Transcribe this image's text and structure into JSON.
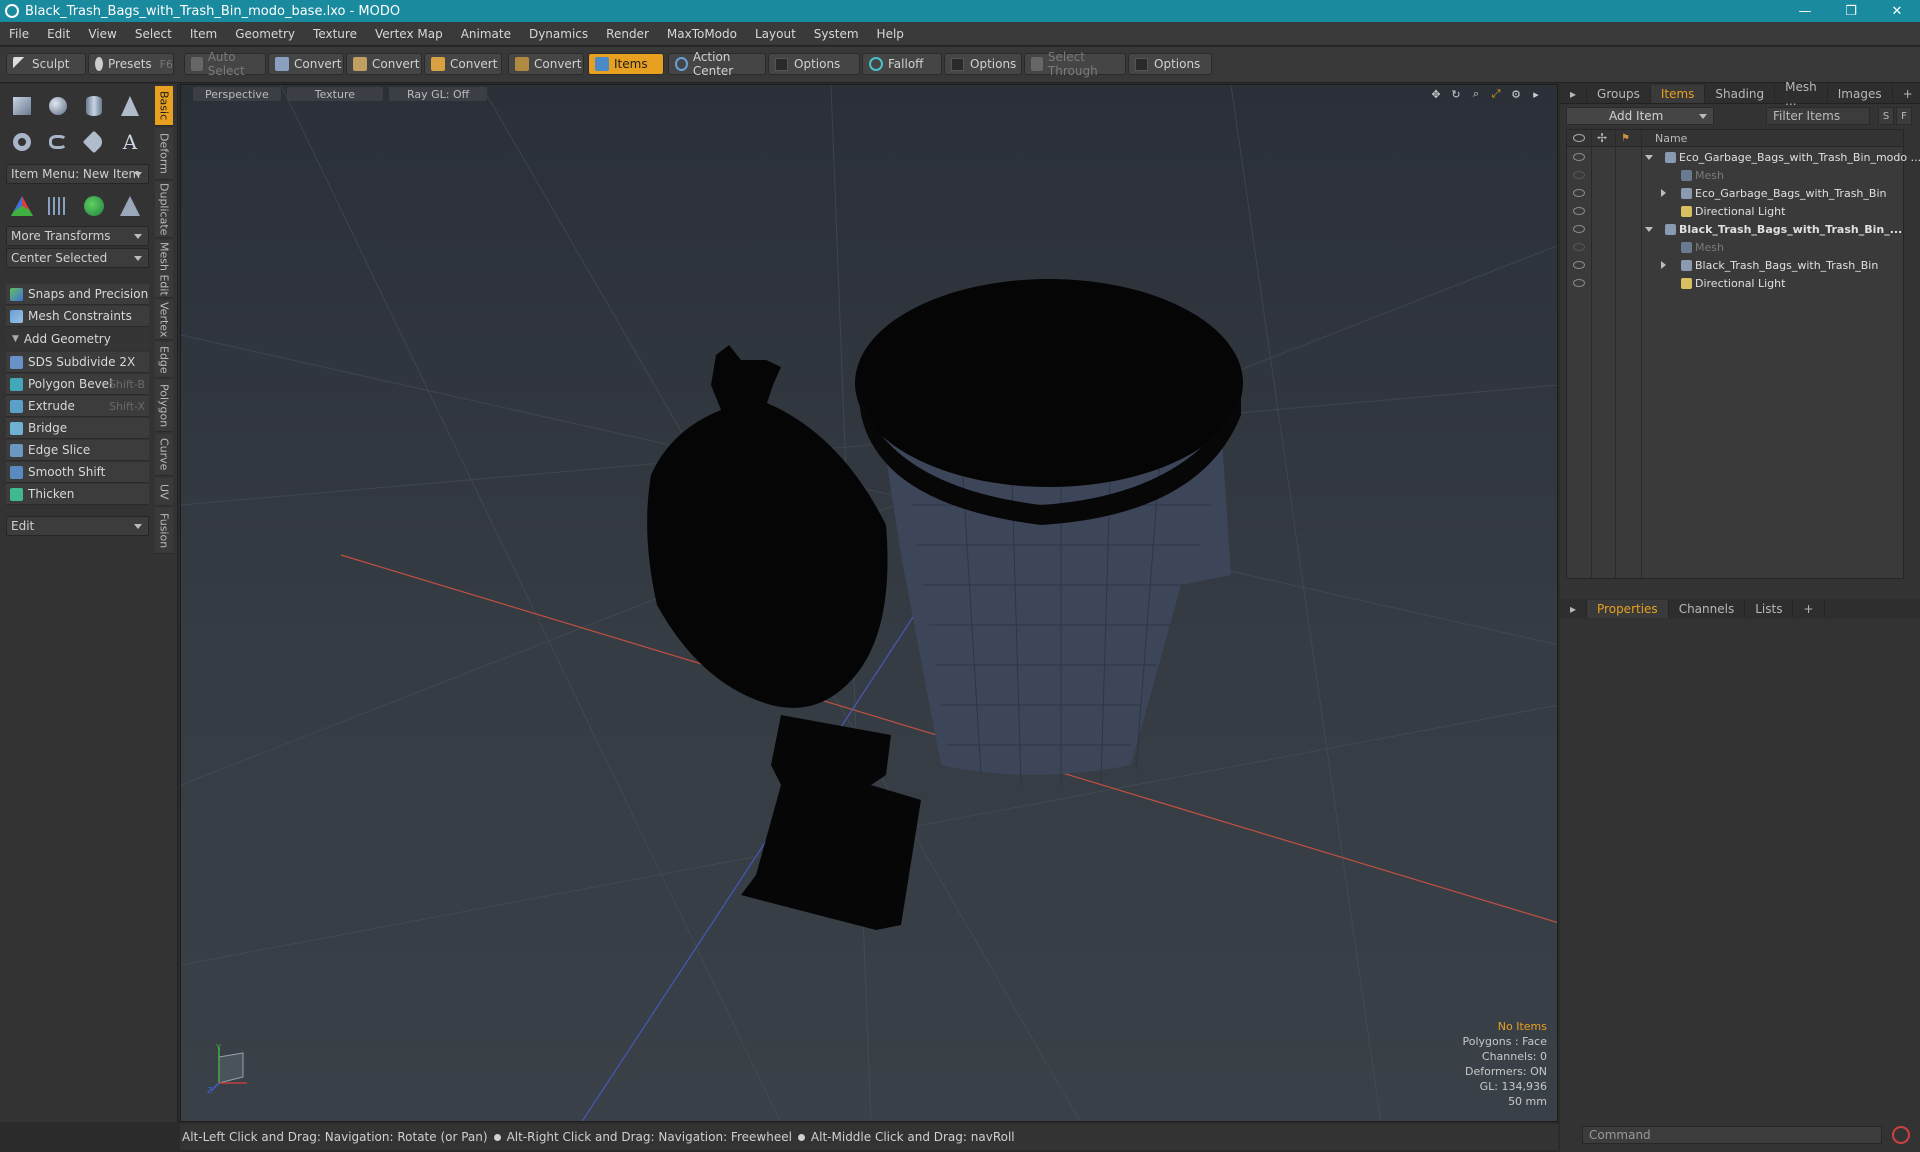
{
  "window": {
    "title": "Black_Trash_Bags_with_Trash_Bin_modo_base.lxo - MODO",
    "minimize": "—",
    "maximize": "❐",
    "close": "✕"
  },
  "menu": [
    "File",
    "Edit",
    "View",
    "Select",
    "Item",
    "Geometry",
    "Texture",
    "Vertex Map",
    "Animate",
    "Dynamics",
    "Render",
    "MaxToModo",
    "Layout",
    "System",
    "Help"
  ],
  "toolbar": {
    "sculpt": "Sculpt",
    "presets": "Presets",
    "presets_key": "F6",
    "auto_select": "Auto Select",
    "convert1": "Convert",
    "convert2": "Convert",
    "convert3": "Convert",
    "convert4": "Convert",
    "items": "Items",
    "action_center": "Action Center",
    "options1": "Options",
    "falloff": "Falloff",
    "options2": "Options",
    "select_through": "Select Through",
    "options3": "Options"
  },
  "left_panel": {
    "item_menu": "Item Menu: New Item",
    "more_transforms": "More Transforms",
    "center_selected": "Center Selected",
    "snaps": "Snaps and Precision",
    "mesh_constraints": "Mesh Constraints",
    "add_geometry": "Add Geometry",
    "tools": [
      {
        "label": "SDS Subdivide 2X",
        "shortcut": ""
      },
      {
        "label": "Polygon Bevel",
        "shortcut": "Shift-B"
      },
      {
        "label": "Extrude",
        "shortcut": "Shift-X"
      },
      {
        "label": "Bridge",
        "shortcut": ""
      },
      {
        "label": "Edge Slice",
        "shortcut": ""
      },
      {
        "label": "Smooth Shift",
        "shortcut": ""
      },
      {
        "label": "Thicken",
        "shortcut": ""
      }
    ],
    "edit_drop": "Edit",
    "vtabs": [
      "Basic",
      "Deform",
      "Duplicate",
      "Mesh Edit",
      "Vertex",
      "Edge",
      "Polygon",
      "Curve",
      "UV",
      "Fusion"
    ]
  },
  "viewport": {
    "tabs": [
      "Perspective",
      "Texture",
      "Ray GL: Off"
    ],
    "info": {
      "no_items": "No Items",
      "polygons": "Polygons : Face",
      "channels": "Channels: 0",
      "deformers": "Deformers: ON",
      "gl": "GL: 134,936",
      "focal": "50 mm"
    },
    "axis": {
      "y": "Y",
      "z": "Z"
    }
  },
  "status": {
    "part1": "Alt-Left Click and Drag: Navigation: Rotate (or Pan)",
    "part2": "Alt-Right Click and Drag: Navigation: Freewheel",
    "part3": "Alt-Middle Click and Drag: navRoll"
  },
  "right_panel": {
    "tabs": [
      "Groups",
      "Items",
      "Shading",
      "Mesh ...",
      "Images"
    ],
    "add_item": "Add Item",
    "filter": "Filter Items",
    "s_btn": "S",
    "f_btn": "F",
    "name_col": "Name",
    "tree": [
      {
        "label": "Eco_Garbage_Bags_with_Trash_Bin_modo ...",
        "indent": 0,
        "expand": "down",
        "style": "normal"
      },
      {
        "label": "Mesh",
        "indent": 1,
        "expand": "",
        "style": "dim"
      },
      {
        "label": "Eco_Garbage_Bags_with_Trash_Bin",
        "indent": 1,
        "expand": "right",
        "style": "normal"
      },
      {
        "label": "Directional Light",
        "indent": 1,
        "expand": "",
        "style": "normal"
      },
      {
        "label": "Black_Trash_Bags_with_Trash_Bin_...",
        "indent": 0,
        "expand": "down",
        "style": "bold"
      },
      {
        "label": "Mesh",
        "indent": 1,
        "expand": "",
        "style": "dim"
      },
      {
        "label": "Black_Trash_Bags_with_Trash_Bin",
        "indent": 1,
        "expand": "right",
        "style": "normal"
      },
      {
        "label": "Directional Light",
        "indent": 1,
        "expand": "",
        "style": "normal"
      }
    ],
    "props_tabs": [
      "Properties",
      "Channels",
      "Lists"
    ],
    "command_placeholder": "Command"
  }
}
